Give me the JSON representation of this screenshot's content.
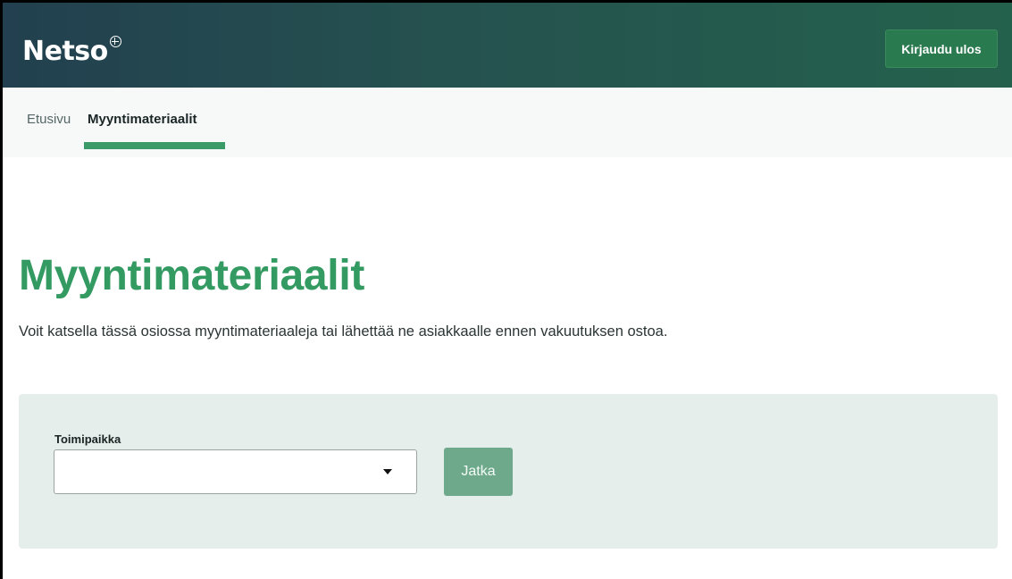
{
  "header": {
    "logo_text": "Netso",
    "logout_label": "Kirjaudu ulos"
  },
  "nav": {
    "home_label": "Etusivu",
    "active_label": "Myyntimateriaalit"
  },
  "main": {
    "title": "Myyntimateriaalit",
    "intro": "Voit katsella tässä osiossa myyntimateriaaleja tai lähettää ne asiakkaalle ennen vakuutuksen ostoa.",
    "form": {
      "location_label": "Toimipaikka",
      "location_value": "",
      "continue_label": "Jatka"
    }
  },
  "colors": {
    "accent": "#339a62",
    "header_start": "#22404f",
    "header_end": "#24614c",
    "panel_bg": "#e5eeea",
    "button_disabled": "#6fa98b"
  }
}
